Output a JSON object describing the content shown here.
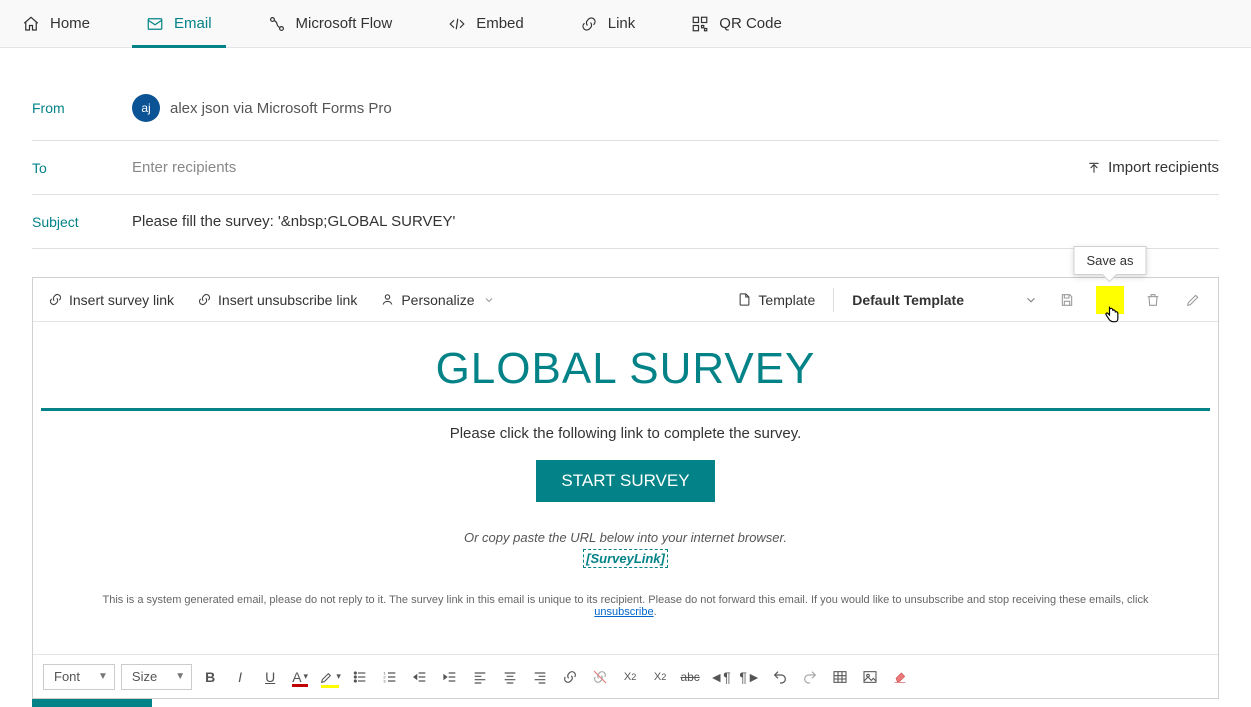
{
  "tabs": {
    "home": "Home",
    "email": "Email",
    "flow": "Microsoft Flow",
    "embed": "Embed",
    "link": "Link",
    "qr": "QR Code"
  },
  "fields": {
    "from_label": "From",
    "to_label": "To",
    "subject_label": "Subject",
    "from_avatar": "aj",
    "from_text": "alex json via Microsoft Forms Pro",
    "recipients_placeholder": "Enter recipients",
    "import_recipients": "Import recipients",
    "subject_value": "Please fill the survey: '&nbsp;GLOBAL SURVEY'"
  },
  "toolbar": {
    "insert_survey_link": "Insert survey link",
    "insert_unsub_link": "Insert unsubscribe link",
    "personalize": "Personalize",
    "template": "Template",
    "default_template": "Default Template",
    "tooltip_save_as": "Save as"
  },
  "body": {
    "title": "GLOBAL SURVEY",
    "instruction": "Please click the following link to complete the survey.",
    "start_btn": "START SURVEY",
    "copy_text": "Or copy paste the URL below into your internet browser.",
    "survey_link": "[SurveyLink]",
    "disclaimer_pre": "This is a system generated email, please do not reply to it. The survey link in this email is unique to its recipient. Please do not forward this email. If you would like to unsubscribe and stop receiving these emails, click ",
    "unsubscribe": "unsubscribe",
    "disclaimer_post": "."
  },
  "format": {
    "font": "Font",
    "size": "Size"
  }
}
